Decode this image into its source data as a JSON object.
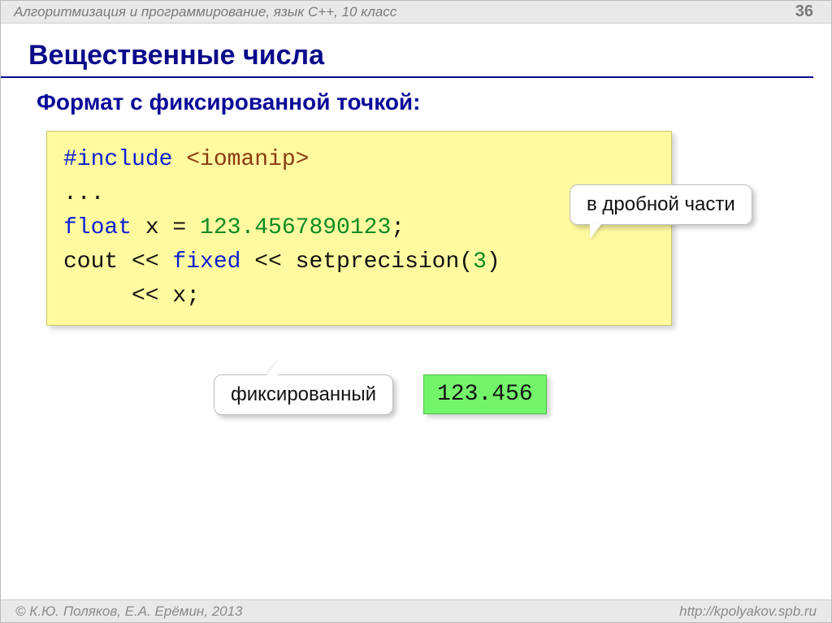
{
  "header": {
    "breadcrumb": "Алгоритмизация и программирование, язык  C++, 10 класс",
    "page_number": "36"
  },
  "title": "Вещественные числа",
  "subtitle": "Формат с фиксированной точкой:",
  "code": {
    "include_kw": "#include",
    "include_lib": "<iomanip>",
    "ellipsis": "...",
    "float_kw": "float",
    "var_decl_rest": " x = ",
    "float_literal": "123.4567890123",
    "semicolon": ";",
    "cout_line_1a": "cout << ",
    "fixed_kw": "fixed",
    "cout_line_1b": " << setprecision(",
    "precision_arg": "3",
    "cout_line_1c": ")",
    "cout_line_2": "<< x;"
  },
  "callouts": {
    "fractional_part": "в дробной части",
    "fixed_label": "фиксированный"
  },
  "result": "123.456",
  "footer": {
    "copyright": "© К.Ю. Поляков, Е.А. Ерёмин, 2013",
    "url": "http://kpolyakov.spb.ru"
  }
}
